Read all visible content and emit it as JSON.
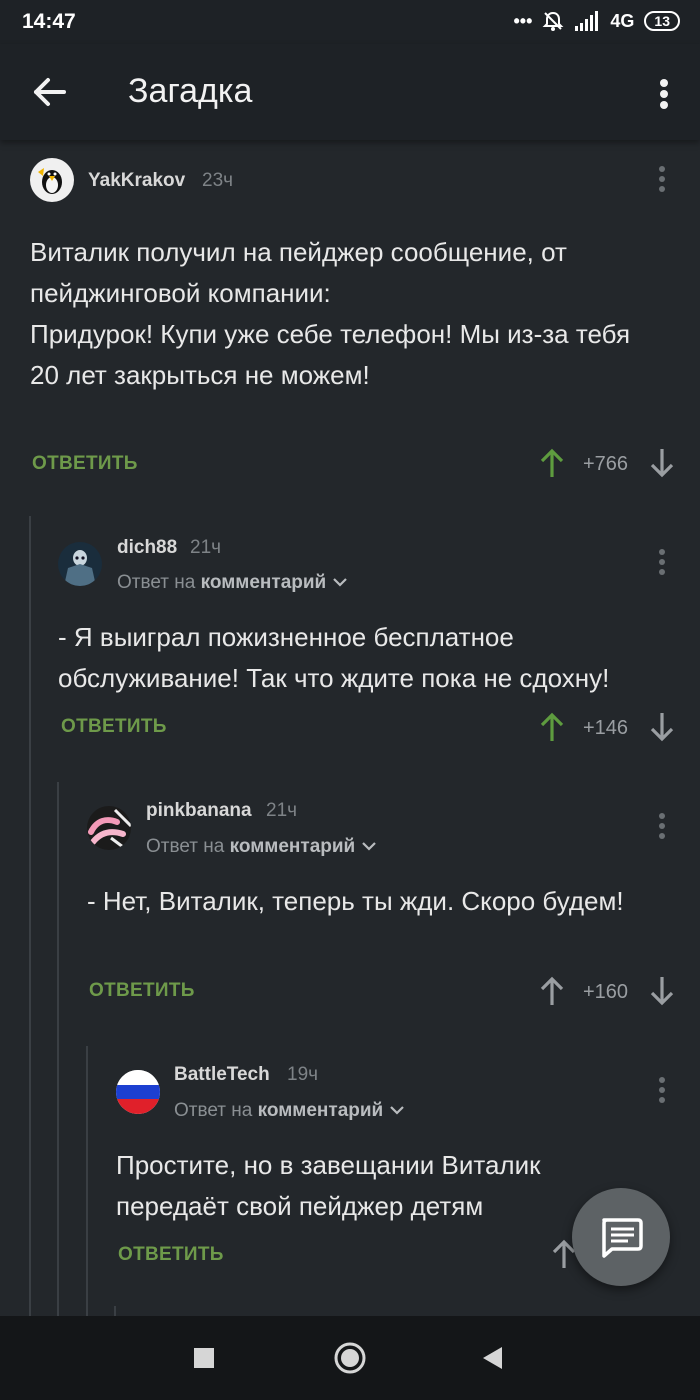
{
  "status_bar": {
    "time": "14:47",
    "dots": "•••",
    "network": "4G",
    "battery": "13",
    "icons": [
      "mute-icon",
      "signal-icon",
      "battery-icon"
    ]
  },
  "app_bar": {
    "title": "Загадка",
    "back_icon": "arrow-left-icon",
    "menu_icon": "more-vert-icon"
  },
  "comments": [
    {
      "author": "YakKrakov",
      "time": "23ч",
      "reply_to": null,
      "text": "Виталик получил на пейджер сообщение, от пейджинговой компании:\nПридурок! Купи уже себе телефон! Мы из-за тебя\n20 лет закрыться не можем!",
      "reply_label": "ОТВЕТИТЬ",
      "score": "+766",
      "upvoted": true
    },
    {
      "author": "dich88",
      "time": "21ч",
      "reply_to_prefix": "Ответ на",
      "reply_to_target": "комментарий",
      "text": "- Я выиграл пожизненное бесплатное обслуживание! Так что ждите пока не сдохну!",
      "reply_label": "ОТВЕТИТЬ",
      "score": "+146",
      "upvoted": true
    },
    {
      "author": "pinkbanana",
      "time": "21ч",
      "reply_to_prefix": "Ответ на",
      "reply_to_target": "комментарий",
      "text": "- Нет, Виталик, теперь ты жди. Скоро будем!",
      "reply_label": "ОТВЕТИТЬ",
      "score": "+160",
      "upvoted": false
    },
    {
      "author": "BattleTech",
      "time": "19ч",
      "reply_to_prefix": "Ответ на",
      "reply_to_target": "комментарий",
      "text": "Простите, но в завещании Виталик передаёт свой пейджер детям",
      "reply_label": "ОТВЕТИТЬ",
      "score": "",
      "upvoted": false
    }
  ],
  "fab": {
    "icon": "comment-icon"
  },
  "nav_bar": {
    "icons": [
      "recent-apps-icon",
      "home-icon",
      "back-triangle-icon"
    ]
  },
  "colors": {
    "background": "#23272b",
    "bar": "#1e2226",
    "reply_green": "#6e9a4a",
    "upvote_green": "#5e9c3f",
    "muted": "#9a9ea2"
  }
}
